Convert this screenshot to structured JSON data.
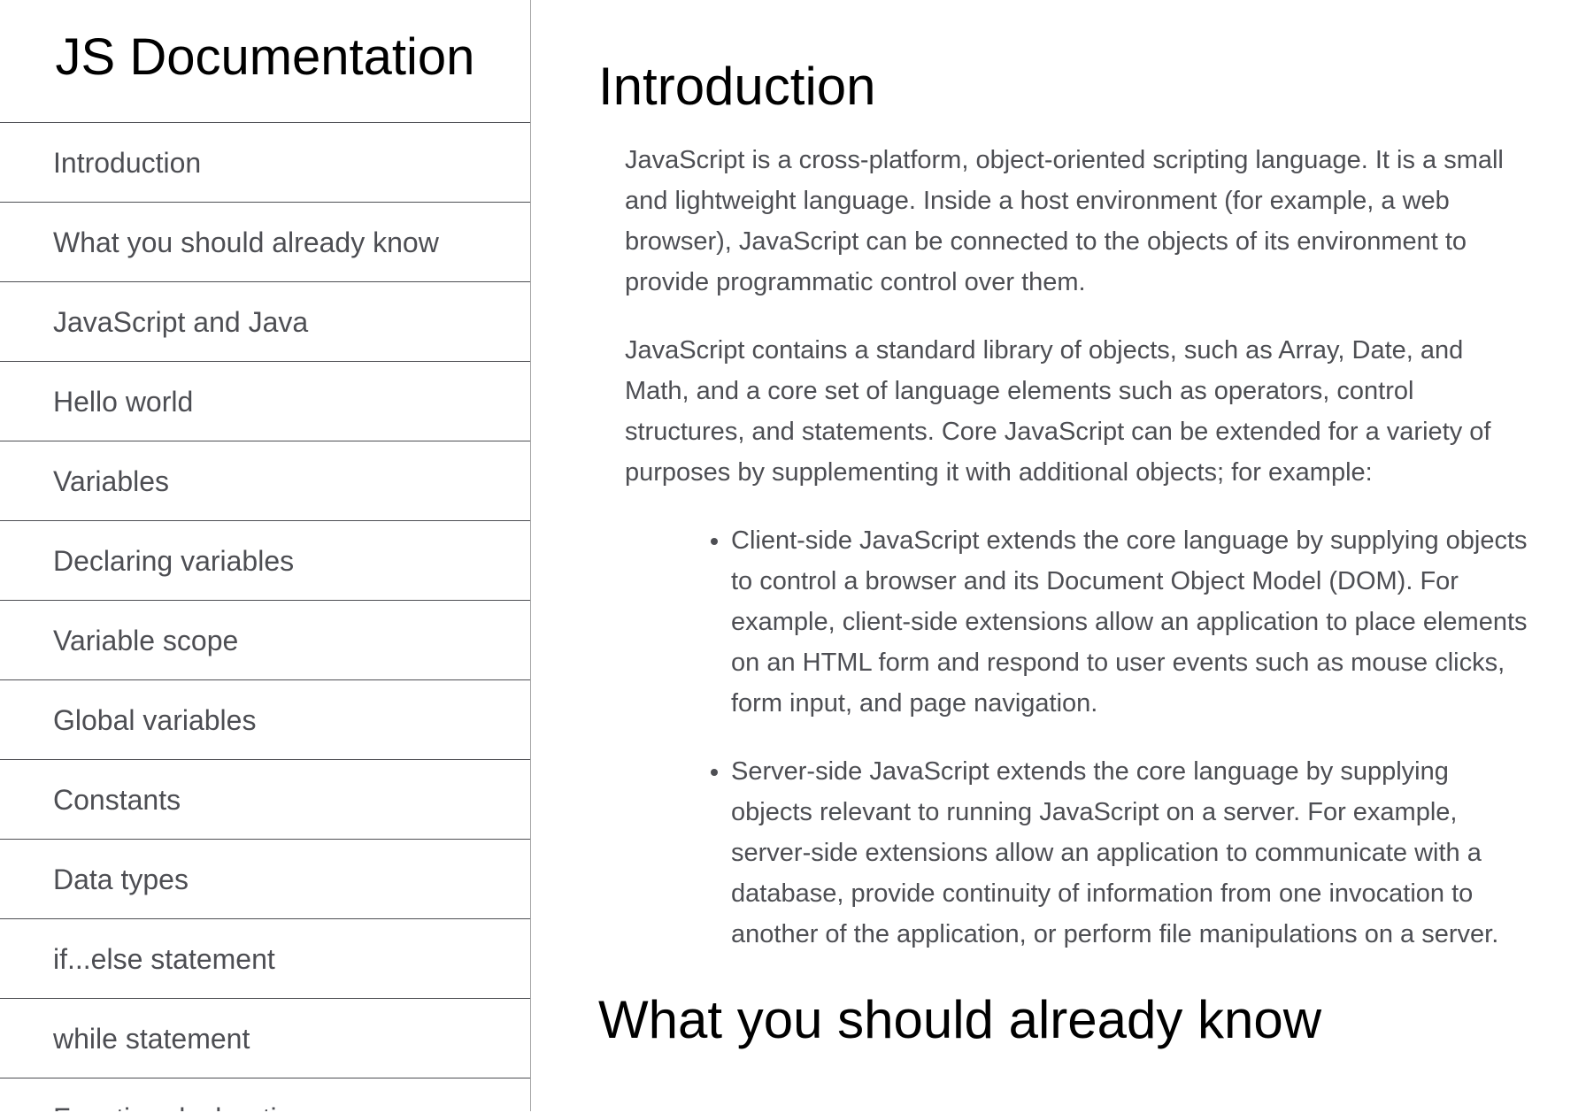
{
  "navbar": {
    "title": "JS Documentation",
    "items": [
      {
        "label": "Introduction"
      },
      {
        "label": "What you should already know"
      },
      {
        "label": "JavaScript and Java"
      },
      {
        "label": "Hello world"
      },
      {
        "label": "Variables"
      },
      {
        "label": "Declaring variables"
      },
      {
        "label": "Variable scope"
      },
      {
        "label": "Global variables"
      },
      {
        "label": "Constants"
      },
      {
        "label": "Data types"
      },
      {
        "label": "if...else statement"
      },
      {
        "label": "while statement"
      },
      {
        "label": "Function declarations"
      }
    ]
  },
  "main": {
    "sections": [
      {
        "title": "Introduction",
        "paragraphs": [
          "JavaScript is a cross-platform, object-oriented scripting language. It is a small and lightweight language. Inside a host environment (for example, a web browser), JavaScript can be connected to the objects of its environment to provide programmatic control over them.",
          "JavaScript contains a standard library of objects, such as Array, Date, and Math, and a core set of language elements such as operators, control structures, and statements. Core JavaScript can be extended for a variety of purposes by supplementing it with additional objects; for example:"
        ],
        "bullets": [
          "Client-side JavaScript extends the core language by supplying objects to control a browser and its Document Object Model (DOM). For example, client-side extensions allow an application to place elements on an HTML form and respond to user events such as mouse clicks, form input, and page navigation.",
          "Server-side JavaScript extends the core language by supplying objects relevant to running JavaScript on a server. For example, server-side extensions allow an application to communicate with a database, provide continuity of information from one invocation to another of the application, or perform file manipulations on a server."
        ]
      },
      {
        "title": "What you should already know"
      }
    ]
  }
}
